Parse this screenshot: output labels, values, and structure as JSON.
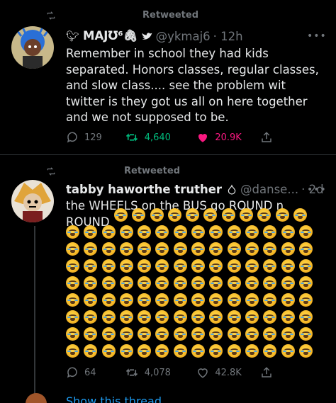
{
  "tweets": [
    {
      "retweet_label": "Retweeted",
      "display_name": "MAJƱ⁶🖇",
      "handle": "@ykmaj6",
      "time": "· 12h",
      "text": "Remember in school they had kids separated. Honors classes, regular classes, and slow class.... see the problem wit twitter is they got us all on here together and we not supposed to be.",
      "replies": "129",
      "retweets": "4,640",
      "likes": "20.9K",
      "liked": true
    },
    {
      "retweet_label": "Retweeted",
      "display_name": "tabby haworthe truther",
      "handle": "@danse...",
      "time": "· 2d",
      "text": "the WHEELS on the BUS go ROUND n ROUND",
      "emoji_name": "loudly-crying-face",
      "replies": "64",
      "retweets": "4,078",
      "likes": "42.8K",
      "liked": false
    }
  ],
  "footer_text": "Show this thread",
  "colors": {
    "accent_like": "#f91880",
    "accent_retweet": "#00ba7c",
    "muted": "#71767b",
    "link": "#1d9bf0"
  }
}
